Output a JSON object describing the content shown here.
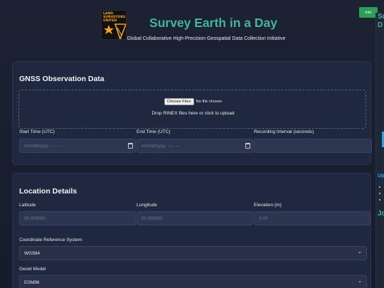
{
  "header": {
    "logo_text": "LAND SURVEYORS UNITED",
    "title": "Survey Earth in a Day",
    "subtitle": "Global Collaborative High-Precision Geospatial Data Collection Initiative",
    "info_label": "Info"
  },
  "side": {
    "heading_1": "Su",
    "heading_2": "D",
    "link": "Up",
    "heading_3": "Jo"
  },
  "gnss": {
    "title": "GNSS Observation Data",
    "choose_files": "Choose Files",
    "no_file": "No file chosen",
    "drop_text": "Drop RINEX files here or click to upload",
    "start_label": "Start Time (UTC)",
    "start_placeholder": "mm/dd/yyyy, --:-- --",
    "end_label": "End Time (UTC)",
    "end_placeholder": "mm/dd/yyyy, --:-- --",
    "interval_label": "Recording Interval (seconds)",
    "interval_value": ""
  },
  "location": {
    "title": "Location Details",
    "latitude_label": "Latitude",
    "latitude_placeholder": "00.000000",
    "longitude_label": "Longitude",
    "longitude_placeholder": "00.000000",
    "elevation_label": "Elevation (m)",
    "elevation_placeholder": "0.00",
    "crs_label": "Coordinate Reference System",
    "crs_value": "WGS84",
    "geoid_label": "Geoid Model",
    "geoid_value": "EGM96"
  },
  "colors": {
    "title": "#43b59a",
    "info_button": "#2e9e57",
    "link": "#3aa0d8",
    "logo_accent": "#f2a31b"
  },
  "icons": [
    "logo-emblem-icon",
    "calendar-icon",
    "chevron-down-icon"
  ]
}
